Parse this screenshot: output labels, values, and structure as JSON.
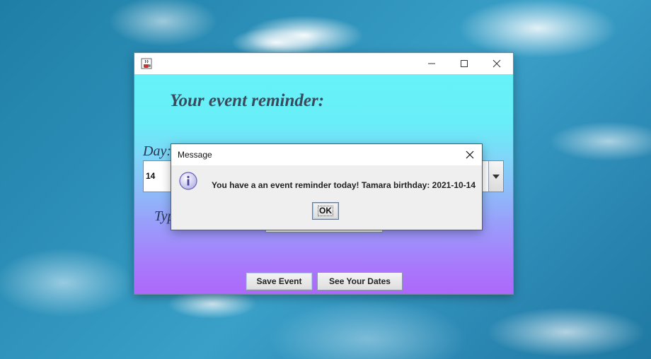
{
  "app": {
    "heading": "Your event reminder:",
    "day_label": "Day:",
    "day_value": "14",
    "type_label": "Typ",
    "save_button": "Save Event",
    "dates_button": "See Your Dates",
    "icon": "java-cup-icon",
    "controls": [
      "minimize-icon",
      "maximize-icon",
      "close-icon"
    ]
  },
  "dialog": {
    "title": "Message",
    "message": "You have a an event reminder today! Tamara birthday: 2021-10-14",
    "ok_label": "OK",
    "icon": "info-icon"
  },
  "colors": {
    "gradient_top": "#66f2f8",
    "gradient_bottom": "#ad68fb",
    "heading": "#3a4a5c"
  }
}
